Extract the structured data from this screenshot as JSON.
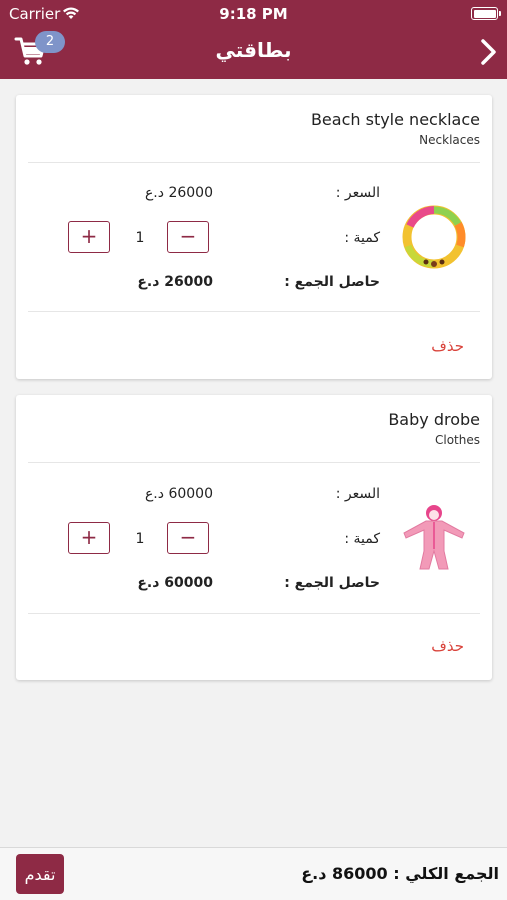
{
  "status_bar": {
    "carrier": "Carrier",
    "time": "9:18 PM"
  },
  "header": {
    "title": "بطاقتي",
    "cart_count": "2"
  },
  "labels": {
    "price": "السعر :",
    "quantity": "كمية :",
    "subtotal": "حاصل الجمع :",
    "delete": "حذف"
  },
  "items": [
    {
      "name": "Beach style necklace",
      "category": "Necklaces",
      "price": "26000 د.ع",
      "quantity": "1",
      "subtotal": "26000 د.ع",
      "image": "necklace-image"
    },
    {
      "name": "Baby drobe",
      "category": "Clothes",
      "price": "60000 د.ع",
      "quantity": "1",
      "subtotal": "60000 د.ع",
      "image": "baby-suit-image"
    }
  ],
  "footer": {
    "total_label": "الجمع الكلي :",
    "total_value": "86000 د.ع",
    "proceed_label": "تقدم"
  },
  "colors": {
    "primary": "#8e2a45",
    "badge": "#7f94c9",
    "delete": "#d9423a"
  }
}
